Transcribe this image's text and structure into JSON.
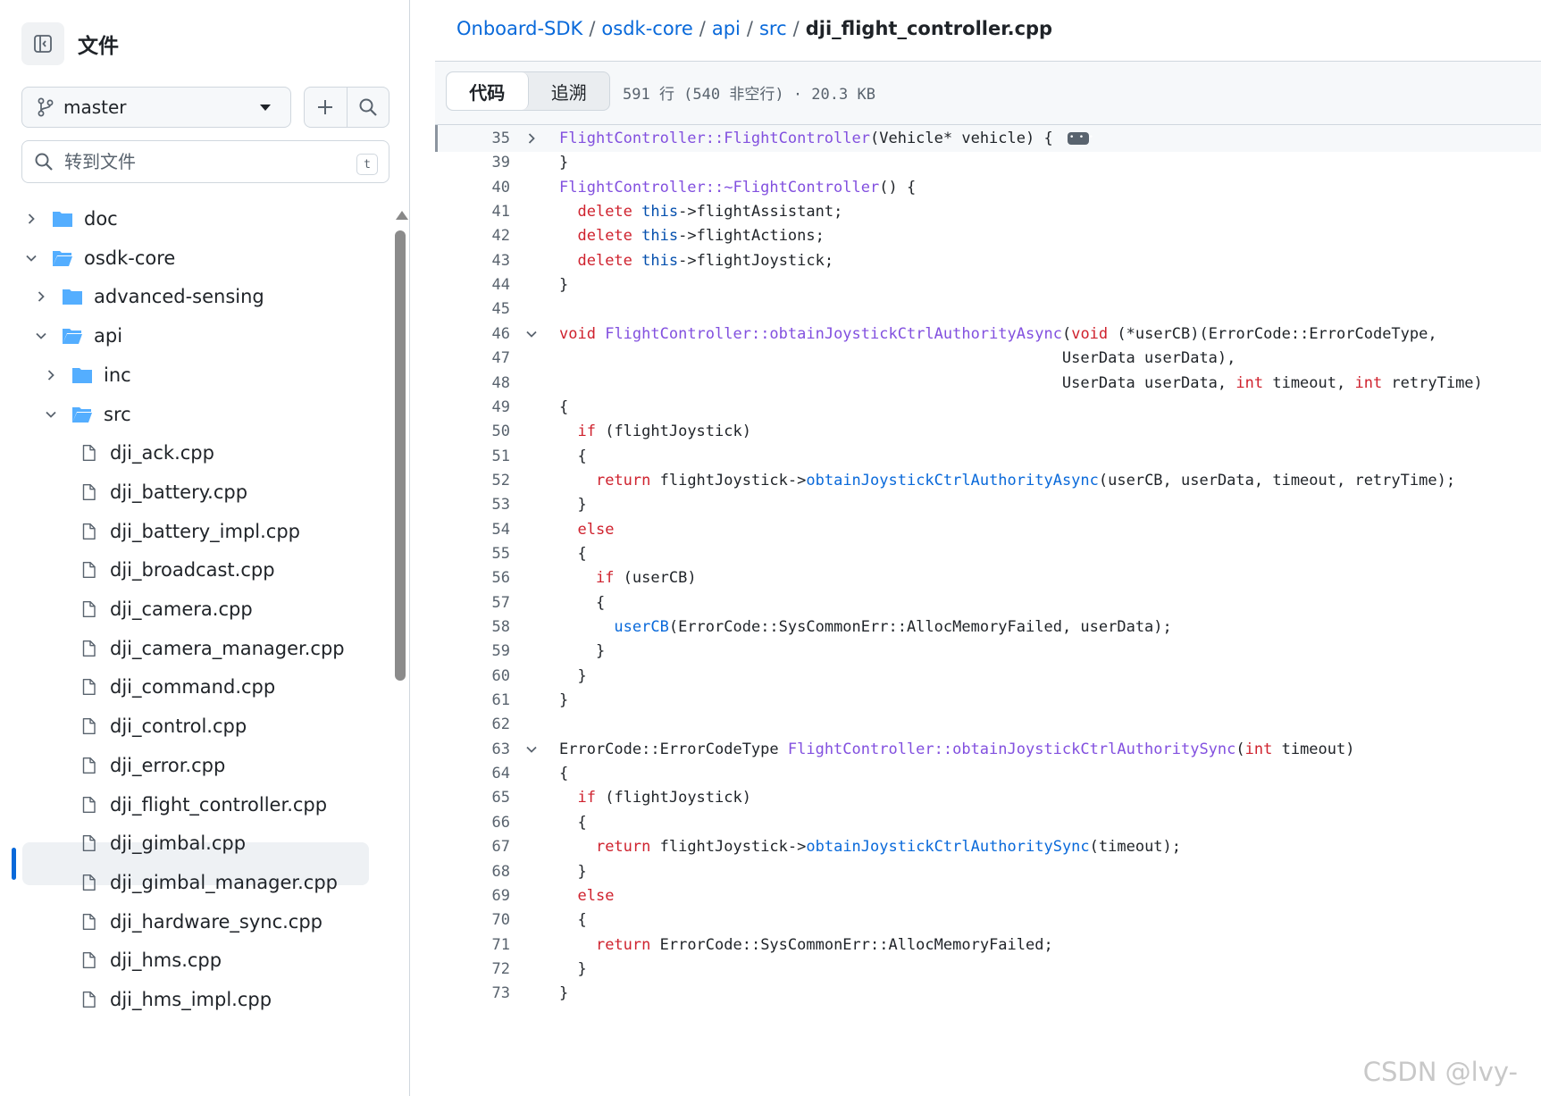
{
  "sidebar": {
    "title": "文件",
    "branch": "master",
    "goto_placeholder": "转到文件",
    "goto_shortcut": "t",
    "tree": [
      {
        "label": "doc",
        "type": "folder",
        "level": 0,
        "expanded": false
      },
      {
        "label": "osdk-core",
        "type": "folder",
        "level": 0,
        "expanded": true
      },
      {
        "label": "advanced-sensing",
        "type": "folder",
        "level": 1,
        "expanded": false
      },
      {
        "label": "api",
        "type": "folder",
        "level": 1,
        "expanded": true
      },
      {
        "label": "inc",
        "type": "folder",
        "level": 2,
        "expanded": false
      },
      {
        "label": "src",
        "type": "folder",
        "level": 2,
        "expanded": true
      },
      {
        "label": "dji_ack.cpp",
        "type": "file",
        "level": 3
      },
      {
        "label": "dji_battery.cpp",
        "type": "file",
        "level": 3
      },
      {
        "label": "dji_battery_impl.cpp",
        "type": "file",
        "level": 3
      },
      {
        "label": "dji_broadcast.cpp",
        "type": "file",
        "level": 3
      },
      {
        "label": "dji_camera.cpp",
        "type": "file",
        "level": 3
      },
      {
        "label": "dji_camera_manager.cpp",
        "type": "file",
        "level": 3
      },
      {
        "label": "dji_command.cpp",
        "type": "file",
        "level": 3
      },
      {
        "label": "dji_control.cpp",
        "type": "file",
        "level": 3
      },
      {
        "label": "dji_error.cpp",
        "type": "file",
        "level": 3
      },
      {
        "label": "dji_flight_controller.cpp",
        "type": "file",
        "level": 3,
        "selected": true
      },
      {
        "label": "dji_gimbal.cpp",
        "type": "file",
        "level": 3
      },
      {
        "label": "dji_gimbal_manager.cpp",
        "type": "file",
        "level": 3
      },
      {
        "label": "dji_hardware_sync.cpp",
        "type": "file",
        "level": 3
      },
      {
        "label": "dji_hms.cpp",
        "type": "file",
        "level": 3
      },
      {
        "label": "dji_hms_impl.cpp",
        "type": "file",
        "level": 3
      }
    ]
  },
  "breadcrumb": [
    {
      "label": "Onboard-SDK",
      "link": true
    },
    {
      "label": "osdk-core",
      "link": true
    },
    {
      "label": "api",
      "link": true
    },
    {
      "label": "src",
      "link": true
    },
    {
      "label": "dji_flight_controller.cpp",
      "link": false
    }
  ],
  "tabs": [
    {
      "label": "代码",
      "active": true
    },
    {
      "label": "追溯",
      "active": false
    }
  ],
  "file_meta": "591 行 (540 非空行) · 20.3 KB",
  "code_lines": [
    {
      "n": "35",
      "fold": "right",
      "hl": true,
      "ellipsis": true,
      "tokens": [
        [
          "f",
          "FlightController::FlightController"
        ],
        [
          "",
          "(Vehicle* vehicle) {"
        ]
      ]
    },
    {
      "n": "39",
      "tokens": [
        [
          "",
          "}"
        ]
      ]
    },
    {
      "n": "40",
      "tokens": [
        [
          "f",
          "FlightController::~FlightController"
        ],
        [
          "",
          "() {"
        ]
      ]
    },
    {
      "n": "41",
      "tokens": [
        [
          "",
          "  "
        ],
        [
          "k",
          "delete"
        ],
        [
          "",
          "",
          " "
        ],
        [
          "c",
          "this"
        ],
        [
          "",
          "->flightAssistant;"
        ]
      ]
    },
    {
      "n": "42",
      "tokens": [
        [
          "",
          "  "
        ],
        [
          "k",
          "delete"
        ],
        [
          "",
          "",
          " "
        ],
        [
          "c",
          "this"
        ],
        [
          "",
          "->flightActions;"
        ]
      ]
    },
    {
      "n": "43",
      "tokens": [
        [
          "",
          "  "
        ],
        [
          "k",
          "delete"
        ],
        [
          "",
          "",
          " "
        ],
        [
          "c",
          "this"
        ],
        [
          "",
          "->flightJoystick;"
        ]
      ]
    },
    {
      "n": "44",
      "tokens": [
        [
          "",
          "}"
        ]
      ]
    },
    {
      "n": "45",
      "tokens": []
    },
    {
      "n": "46",
      "fold": "down",
      "tokens": [
        [
          "k",
          "void"
        ],
        [
          "",
          " "
        ],
        [
          "f",
          "FlightController::obtainJoystickCtrlAuthorityAsync"
        ],
        [
          "",
          "("
        ],
        [
          "k",
          "void"
        ],
        [
          "",
          " (*userCB)(ErrorCode::ErrorCodeType,"
        ]
      ]
    },
    {
      "n": "47",
      "tokens": [
        [
          "",
          "                                                       UserData userData),"
        ]
      ]
    },
    {
      "n": "48",
      "tokens": [
        [
          "",
          "                                                       UserData userData, "
        ],
        [
          "k",
          "int"
        ],
        [
          "",
          " timeout, "
        ],
        [
          "k",
          "int"
        ],
        [
          "",
          " retryTime)"
        ]
      ]
    },
    {
      "n": "49",
      "tokens": [
        [
          "",
          "{"
        ]
      ]
    },
    {
      "n": "50",
      "tokens": [
        [
          "",
          "  "
        ],
        [
          "k",
          "if"
        ],
        [
          "",
          " (flightJoystick)"
        ]
      ]
    },
    {
      "n": "51",
      "tokens": [
        [
          "",
          "  {"
        ]
      ]
    },
    {
      "n": "52",
      "tokens": [
        [
          "",
          "    "
        ],
        [
          "k",
          "return"
        ],
        [
          "",
          " flightJoystick->"
        ],
        [
          "fc",
          "obtainJoystickCtrlAuthorityAsync"
        ],
        [
          "",
          "(userCB, userData, timeout, retryTime);"
        ]
      ]
    },
    {
      "n": "53",
      "tokens": [
        [
          "",
          "  }"
        ]
      ]
    },
    {
      "n": "54",
      "tokens": [
        [
          "",
          "  "
        ],
        [
          "k",
          "else"
        ]
      ]
    },
    {
      "n": "55",
      "tokens": [
        [
          "",
          "  {"
        ]
      ]
    },
    {
      "n": "56",
      "tokens": [
        [
          "",
          "    "
        ],
        [
          "k",
          "if"
        ],
        [
          "",
          " (userCB)"
        ]
      ]
    },
    {
      "n": "57",
      "tokens": [
        [
          "",
          "    {"
        ]
      ]
    },
    {
      "n": "58",
      "tokens": [
        [
          "",
          "      "
        ],
        [
          "fc",
          "userCB"
        ],
        [
          "",
          "(ErrorCode::SysCommonErr::AllocMemoryFailed, userData);"
        ]
      ]
    },
    {
      "n": "59",
      "tokens": [
        [
          "",
          "    }"
        ]
      ]
    },
    {
      "n": "60",
      "tokens": [
        [
          "",
          "  }"
        ]
      ]
    },
    {
      "n": "61",
      "tokens": [
        [
          "",
          "}"
        ]
      ]
    },
    {
      "n": "62",
      "tokens": []
    },
    {
      "n": "63",
      "fold": "down",
      "tokens": [
        [
          "",
          "ErrorCode::ErrorCodeType "
        ],
        [
          "f",
          "FlightController::obtainJoystickCtrlAuthoritySync"
        ],
        [
          "",
          "("
        ],
        [
          "k",
          "int"
        ],
        [
          "",
          " timeout)"
        ]
      ]
    },
    {
      "n": "64",
      "tokens": [
        [
          "",
          "{"
        ]
      ]
    },
    {
      "n": "65",
      "tokens": [
        [
          "",
          "  "
        ],
        [
          "k",
          "if"
        ],
        [
          "",
          " (flightJoystick)"
        ]
      ]
    },
    {
      "n": "66",
      "tokens": [
        [
          "",
          "  {"
        ]
      ]
    },
    {
      "n": "67",
      "tokens": [
        [
          "",
          "    "
        ],
        [
          "k",
          "return"
        ],
        [
          "",
          " flightJoystick->"
        ],
        [
          "fc",
          "obtainJoystickCtrlAuthoritySync"
        ],
        [
          "",
          "(timeout);"
        ]
      ]
    },
    {
      "n": "68",
      "tokens": [
        [
          "",
          "  }"
        ]
      ]
    },
    {
      "n": "69",
      "tokens": [
        [
          "",
          "  "
        ],
        [
          "k",
          "else"
        ]
      ]
    },
    {
      "n": "70",
      "tokens": [
        [
          "",
          "  {"
        ]
      ]
    },
    {
      "n": "71",
      "tokens": [
        [
          "",
          "    "
        ],
        [
          "k",
          "return"
        ],
        [
          "",
          " ErrorCode::SysCommonErr::AllocMemoryFailed;"
        ]
      ]
    },
    {
      "n": "72",
      "tokens": [
        [
          "",
          "  }"
        ]
      ]
    },
    {
      "n": "73",
      "tokens": [
        [
          "",
          "}"
        ]
      ]
    }
  ],
  "watermark": "CSDN @lvy-",
  "colors": {
    "link": "#0969da",
    "keyword": "#cf222e",
    "function": "#8250df",
    "constant": "#0550ae",
    "selected_bar": "#0969da",
    "folder": "#54aeff"
  }
}
